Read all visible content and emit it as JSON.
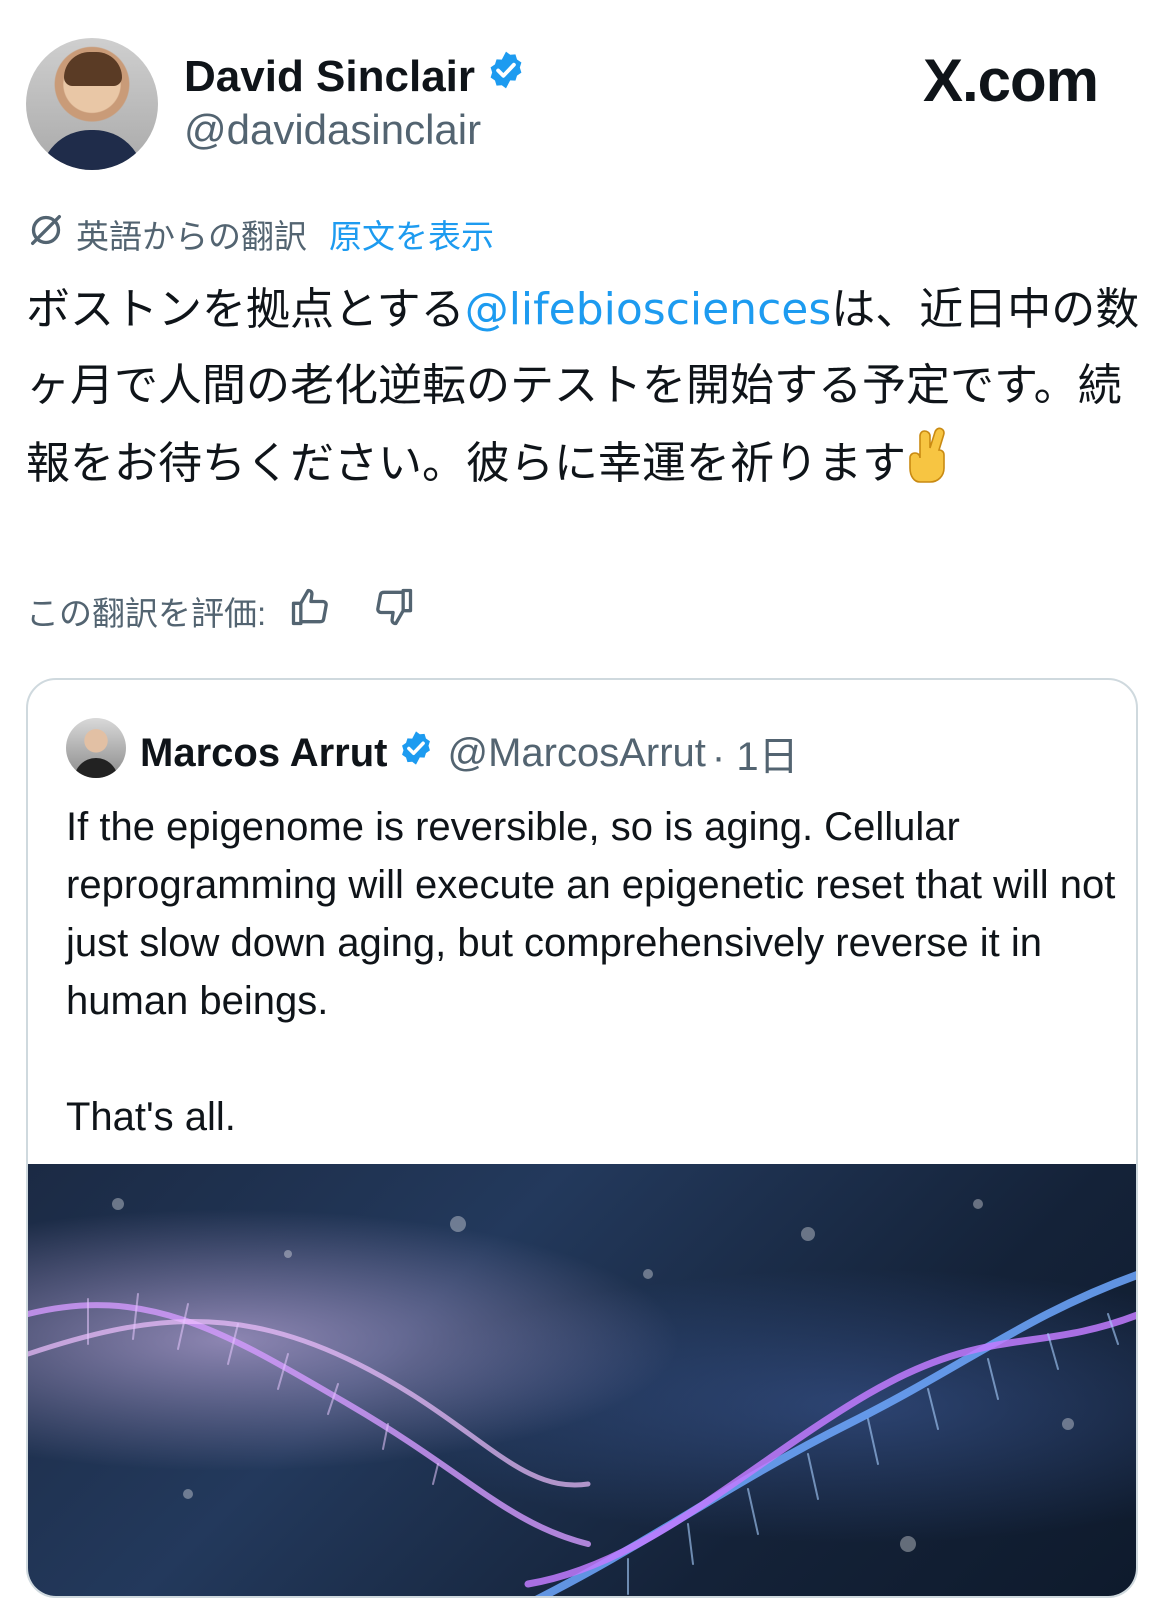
{
  "author": {
    "name": "David Sinclair",
    "handle": "@davidasinclair"
  },
  "brand": "X.com",
  "translation": {
    "label": "英語からの翻訳",
    "show_original": "原文を表示"
  },
  "tweet": {
    "text_before_mention": "ボストンを拠点とする",
    "mention": "@lifebiosciences",
    "text_after_mention": "は、近日中の数ヶ月で人間の老化逆転のテストを開始する予定です。続報をお待ちください。彼らに幸運を祈ります"
  },
  "rate": {
    "label": "この翻訳を評価:"
  },
  "quoted": {
    "name": "Marcos Arrut",
    "handle": "@MarcosArrut",
    "time": "· 1日",
    "text": "If the epigenome is reversible, so is aging. Cellular reprogramming will execute an epigenetic reset that will not just slow down aging, but comprehensively reverse it in human beings.\n\nThat's all."
  },
  "colors": {
    "link": "#1d9bf0",
    "verified": "#1d9bf0",
    "secondary_text": "#536471"
  },
  "icons": [
    "verified-badge-icon",
    "translate-icon",
    "thumbs-up-icon",
    "thumbs-down-icon",
    "crossed-fingers-emoji"
  ]
}
